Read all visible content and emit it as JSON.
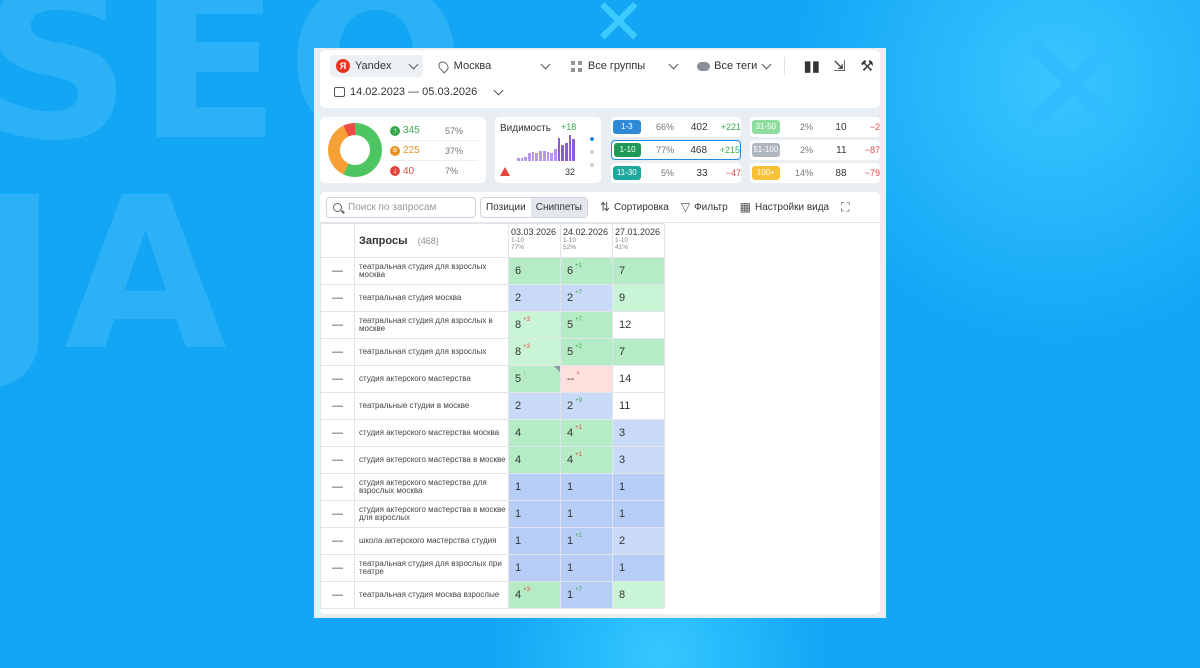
{
  "filters": {
    "engine": "Yandex",
    "engine_badge": "Я",
    "region": "Москва",
    "groups": "Все группы",
    "tags": "Все теги",
    "date_range": "14.02.2023 — 05.03.2026"
  },
  "summary": {
    "up": {
      "count": "345",
      "pct": "57%"
    },
    "same": {
      "count": "225",
      "pct": "37%"
    },
    "down": {
      "count": "40",
      "pct": "7%"
    },
    "visibility_label": "Видимость",
    "visibility_delta": "+18",
    "visibility_bars": [
      0.1,
      0.1,
      0.15,
      0.3,
      0.35,
      0.3,
      0.4,
      0.4,
      0.35,
      0.3,
      0.45,
      0.9,
      0.6,
      0.7,
      1.0,
      0.85
    ],
    "warnings": "32"
  },
  "ranges": [
    {
      "label": "1-3",
      "pct": "66%",
      "count": "402",
      "delta": "+221",
      "chip_bg": "#2e8ad6",
      "chip_color": "#ffffff"
    },
    {
      "label": "1-10",
      "pct": "77%",
      "count": "468",
      "delta": "+215",
      "chip_bg": "#1f9a5a",
      "chip_color": "#ffffff"
    },
    {
      "label": "11-30",
      "pct": "5%",
      "count": "33",
      "delta": "−47",
      "chip_bg": "#1fa8a0",
      "chip_color": "#ffffff"
    },
    {
      "label": "31-50",
      "pct": "2%",
      "count": "10",
      "delta": "−2",
      "chip_bg": "#8fdc9f",
      "chip_color": "#ffffff"
    },
    {
      "label": "51-100",
      "pct": "2%",
      "count": "11",
      "delta": "−87",
      "chip_bg": "#aeb5bd",
      "chip_color": "#ffffff"
    },
    {
      "label": "100+",
      "pct": "14%",
      "count": "88",
      "delta": "−79",
      "chip_bg": "#f7c137",
      "chip_color": "#ffffff"
    }
  ],
  "toolbar": {
    "search_placeholder": "Поиск по запросам",
    "tab_positions": "Позиции",
    "tab_snippets": "Сниппеты",
    "sort": "Сортировка",
    "filter": "Фильтр",
    "view_settings": "Настройки вида"
  },
  "table": {
    "queries_label": "Запросы",
    "queries_count": "(468)",
    "dates": [
      {
        "date": "03.03.2026",
        "range": "1-10",
        "pct": "77%"
      },
      {
        "date": "24.02.2026",
        "range": "1-10",
        "pct": "52%"
      },
      {
        "date": "27.01.2026",
        "range": "1-10",
        "pct": "41%"
      }
    ],
    "rows": [
      {
        "q": "театральная студия для взрослых москва",
        "c": [
          {
            "v": "6",
            "bg": "c-green1"
          },
          {
            "v": "6",
            "d": "+1",
            "dc": "up",
            "bg": "c-green1"
          },
          {
            "v": "7",
            "bg": "c-green1"
          }
        ]
      },
      {
        "q": "театральная студия москва",
        "c": [
          {
            "v": "2",
            "bg": "c-blue1"
          },
          {
            "v": "2",
            "d": "+7",
            "dc": "up",
            "bg": "c-blue1"
          },
          {
            "v": "9",
            "bg": "c-green2"
          }
        ]
      },
      {
        "q": "театральная студия для взрослых в москве",
        "c": [
          {
            "v": "8",
            "d": "+3",
            "dc": "dn",
            "bg": "c-green2"
          },
          {
            "v": "5",
            "d": "+7",
            "dc": "up",
            "bg": "c-green1"
          },
          {
            "v": "12",
            "bg": "c-white"
          }
        ]
      },
      {
        "q": "театральная студия для взрослых",
        "c": [
          {
            "v": "8",
            "d": "+3",
            "dc": "dn",
            "bg": "c-green2"
          },
          {
            "v": "5",
            "d": "+2",
            "dc": "up",
            "bg": "c-green1"
          },
          {
            "v": "7",
            "bg": "c-green1"
          }
        ]
      },
      {
        "q": "студия актерского мастерства",
        "c": [
          {
            "v": "5",
            "d": "↑",
            "dc": "up",
            "bg": "c-green1",
            "corner": true
          },
          {
            "v": "--",
            "d": "×",
            "dc": "dn",
            "bg": "c-red"
          },
          {
            "v": "14",
            "bg": "c-white"
          }
        ]
      },
      {
        "q": "театральные студии в москве",
        "c": [
          {
            "v": "2",
            "bg": "c-blue1"
          },
          {
            "v": "2",
            "d": "+9",
            "dc": "up",
            "bg": "c-blue1"
          },
          {
            "v": "11",
            "bg": "c-white"
          }
        ]
      },
      {
        "q": "студия актерского мастерства москва",
        "c": [
          {
            "v": "4",
            "bg": "c-green1"
          },
          {
            "v": "4",
            "d": "+1",
            "dc": "dn",
            "bg": "c-green1"
          },
          {
            "v": "3",
            "bg": "c-blue1"
          }
        ]
      },
      {
        "q": "студия актерского мастерства в москве",
        "c": [
          {
            "v": "4",
            "bg": "c-green1"
          },
          {
            "v": "4",
            "d": "+1",
            "dc": "dn",
            "bg": "c-green1"
          },
          {
            "v": "3",
            "bg": "c-blue1"
          }
        ]
      },
      {
        "q": "студия актерского мастерства для взрослых москва",
        "c": [
          {
            "v": "1",
            "bg": "c-blue2"
          },
          {
            "v": "1",
            "bg": "c-blue2"
          },
          {
            "v": "1",
            "bg": "c-blue2"
          }
        ]
      },
      {
        "q": "студия актерского мастерства в москве для взрослых",
        "c": [
          {
            "v": "1",
            "bg": "c-blue2"
          },
          {
            "v": "1",
            "bg": "c-blue2"
          },
          {
            "v": "1",
            "bg": "c-blue2"
          }
        ]
      },
      {
        "q": "школа актерского мастерства студия",
        "c": [
          {
            "v": "1",
            "bg": "c-blue2"
          },
          {
            "v": "1",
            "d": "+1",
            "dc": "up",
            "bg": "c-blue2"
          },
          {
            "v": "2",
            "bg": "c-blue1"
          }
        ]
      },
      {
        "q": "театральная студия для взрослых при театре",
        "c": [
          {
            "v": "1",
            "bg": "c-blue2"
          },
          {
            "v": "1",
            "bg": "c-blue2"
          },
          {
            "v": "1",
            "bg": "c-blue2"
          }
        ]
      },
      {
        "q": "театральная студия москва взрослые",
        "c": [
          {
            "v": "4",
            "d": "+3",
            "dc": "dn",
            "bg": "c-green1"
          },
          {
            "v": "1",
            "d": "+7",
            "dc": "up",
            "bg": "c-blue2"
          },
          {
            "v": "8",
            "bg": "c-green2"
          }
        ]
      }
    ]
  }
}
